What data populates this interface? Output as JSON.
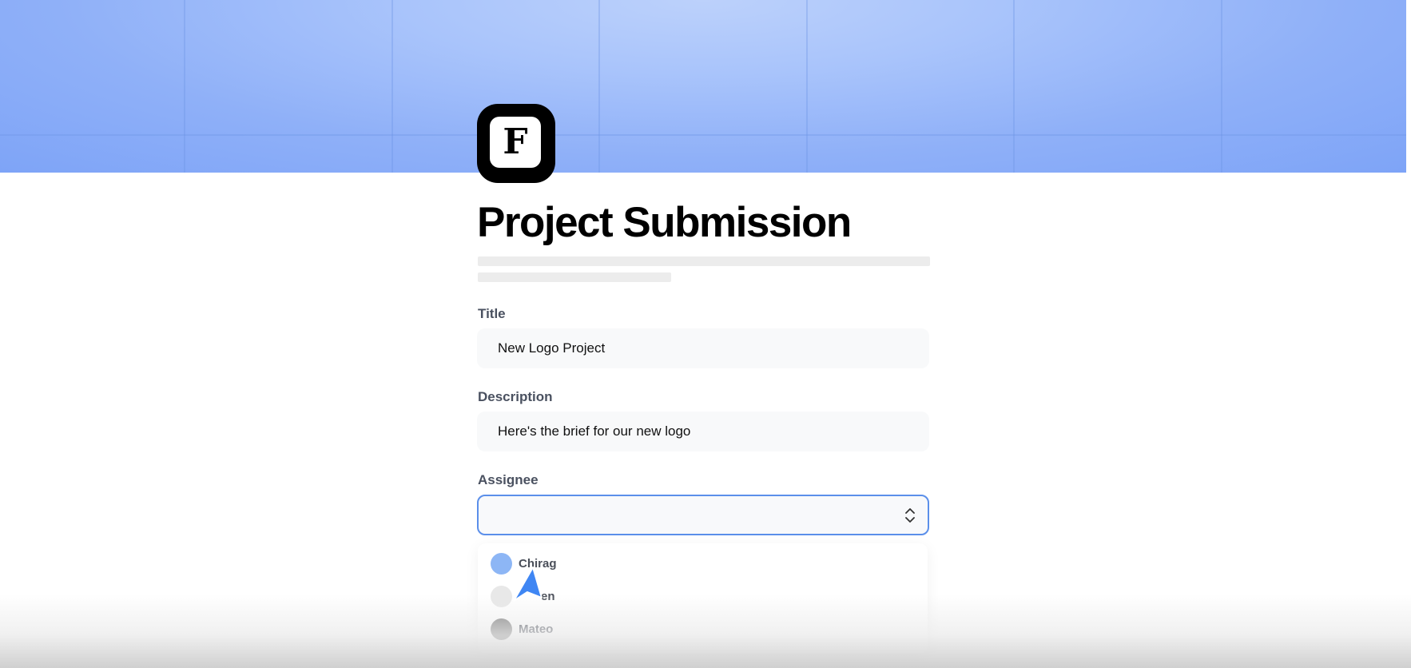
{
  "form": {
    "title": "Project Submission",
    "fields": {
      "title": {
        "label": "Title",
        "value": "New Logo Project"
      },
      "description": {
        "label": "Description",
        "value": "Here's the brief for our new logo"
      },
      "assignee": {
        "label": "Assignee",
        "value": ""
      }
    },
    "assignee_options": [
      {
        "label": "Chirag",
        "color": "#8db6f5"
      },
      {
        "label": "en",
        "color": "#e8e8e8"
      },
      {
        "label": "Mateo",
        "color": "#777777"
      }
    ]
  },
  "logo": {
    "letter": "F"
  },
  "icons": {
    "logo": "framer-f-logo-icon",
    "select_chevrons": "chevron-up-down-icon",
    "cursor": "pointer-arrow-icon"
  },
  "colors": {
    "banner": "#a9c4fb",
    "select_border": "#5b8fea",
    "cursor": "#3f86f3"
  }
}
